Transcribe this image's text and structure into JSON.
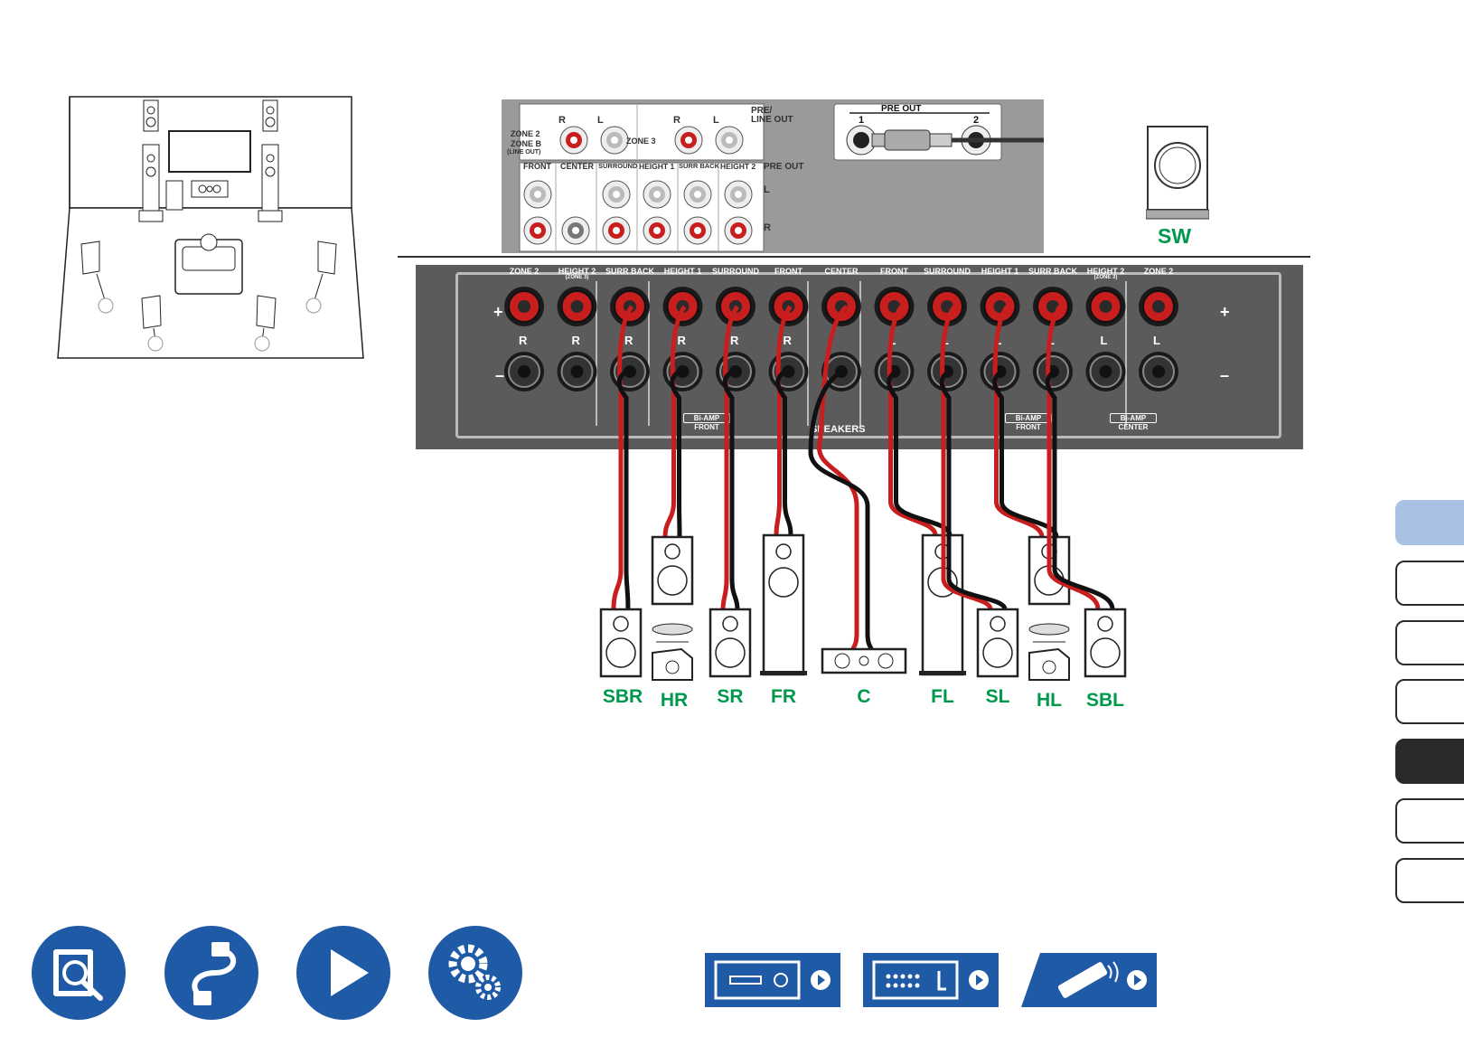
{
  "rear_panel": {
    "preout_top": {
      "zone2_label": "ZONE 2",
      "zoneb_label": "ZONE B",
      "lineout_label": "(LINE OUT)",
      "zone3_label": "ZONE 3",
      "R": "R",
      "L": "L",
      "pre_line_out_1": "PRE/",
      "pre_line_out_2": "LINE OUT",
      "pre_out_header": "PRE OUT",
      "pre_out_1": "1",
      "pre_out_2": "2",
      "columns": [
        "FRONT",
        "CENTER",
        "SURROUND",
        "HEIGHT 1",
        "SURR BACK",
        "HEIGHT 2"
      ],
      "pre_out_label": "PRE OUT"
    },
    "speaker_terminals": {
      "right_channels": [
        "ZONE 2",
        "HEIGHT 2",
        "SURR BACK",
        "HEIGHT 1",
        "SURROUND",
        "FRONT"
      ],
      "center": "CENTER",
      "left_channels": [
        "FRONT",
        "SURROUND",
        "HEIGHT 1",
        "SURR BACK",
        "HEIGHT 2",
        "ZONE 2"
      ],
      "zone3_sub": "(ZONE 3)",
      "R": "R",
      "L": "L",
      "plus": "+",
      "minus": "–",
      "biamp": "Bi-AMP",
      "biamp_front": "FRONT",
      "biamp_center": "CENTER",
      "speakers_label": "SPEAKERS"
    }
  },
  "speaker_labels": [
    "SBR",
    "HR",
    "SR",
    "FR",
    "C",
    "FL",
    "SL",
    "HL",
    "SBL"
  ],
  "subwoofer_label": "SW",
  "colors": {
    "label_green": "#00994c",
    "terminal_red": "#c81e1e",
    "nav_blue": "#1f5aa6",
    "panel_gray": "#5b5b5b",
    "tab_highlight": "#a9c1e3"
  },
  "side_tabs": {
    "count": 7,
    "active_index": 4,
    "highlight_index": 0
  },
  "bottom_icons": [
    "contents-icon",
    "connections-icon",
    "playback-icon",
    "setup-icon"
  ],
  "nav_buttons": [
    "front-panel-icon",
    "rear-panel-icon",
    "remote-icon"
  ]
}
